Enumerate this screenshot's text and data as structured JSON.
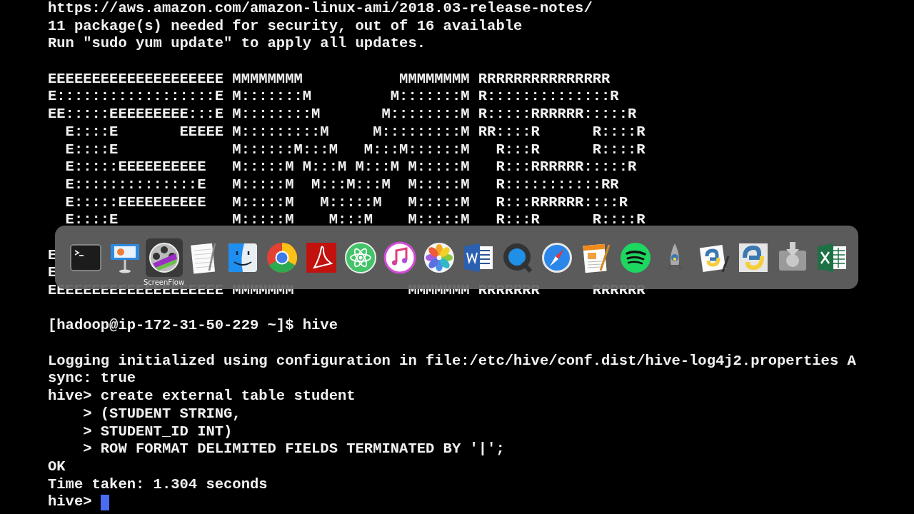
{
  "terminal": {
    "blocks": [
      {
        "lines": [
          "https://aws.amazon.com/amazon-linux-ami/2018.03-release-notes/",
          "11 package(s) needed for security, out of 16 available",
          "Run \"sudo yum update\" to apply all updates."
        ]
      },
      {
        "lines": [
          "EEEEEEEEEEEEEEEEEEEE MMMMMMMM           MMMMMMMM RRRRRRRRRRRRRRR",
          "E::::::::::::::::::E M:::::::M         M:::::::M R::::::::::::::R",
          "EE:::::EEEEEEEEE:::E M::::::::M       M::::::::M R:::::RRRRRR:::::R",
          "  E::::E       EEEEE M:::::::::M     M:::::::::M RR::::R      R::::R",
          "  E::::E             M::::::M:::M   M:::M::::::M   R:::R      R::::R",
          "  E:::::EEEEEEEEEE   M:::::M M:::M M:::M M:::::M   R:::RRRRRR:::::R",
          "  E::::::::::::::E   M:::::M  M:::M:::M  M:::::M   R:::::::::::RR",
          "  E:::::EEEEEEEEEE   M:::::M   M:::::M   M:::::M   R:::RRRRRR::::R",
          "  E::::E             M:::::M    M:::M    M:::::M   R:::R      R::::R"
        ]
      },
      {
        "lines": [
          "E",
          "E",
          "EEEEEEEEEEEEEEEEEEEE MMMMMMM             MMMMMMM RRRRRRR      RRRRRR"
        ]
      },
      {
        "lines": [
          "[hadoop@ip-172-31-50-229 ~]$ hive"
        ]
      },
      {
        "lines": [
          "Logging initialized using configuration in file:/etc/hive/conf.dist/hive-log4j2.properties A",
          "sync: true",
          "hive> create external table student",
          "    > (STUDENT STRING,",
          "    > STUDENT_ID INT)",
          "    > ROW FORMAT DELIMITED FIELDS TERMINATED BY '|';",
          "OK",
          "Time taken: 1.304 seconds",
          "hive> "
        ]
      }
    ]
  },
  "dock": {
    "apps": [
      {
        "kind": "terminal",
        "selected": false
      },
      {
        "kind": "presentation",
        "selected": false
      },
      {
        "kind": "film",
        "selected": true,
        "label": "ScreenFlow"
      },
      {
        "kind": "notepad",
        "selected": false
      },
      {
        "kind": "face",
        "selected": false
      },
      {
        "kind": "ring",
        "selected": false
      },
      {
        "kind": "swirl",
        "selected": false
      },
      {
        "kind": "atom",
        "selected": false
      },
      {
        "kind": "music",
        "selected": false
      },
      {
        "kind": "flower",
        "selected": false
      },
      {
        "kind": "worddoc",
        "selected": false
      },
      {
        "kind": "lens",
        "selected": false
      },
      {
        "kind": "compass",
        "selected": false
      },
      {
        "kind": "penpaper",
        "selected": false
      },
      {
        "kind": "waves",
        "selected": false
      },
      {
        "kind": "rocket",
        "selected": false
      },
      {
        "kind": "snakedoc",
        "selected": false
      },
      {
        "kind": "snake",
        "selected": false
      },
      {
        "kind": "drive",
        "selected": false
      },
      {
        "kind": "sheet",
        "selected": false
      }
    ]
  }
}
